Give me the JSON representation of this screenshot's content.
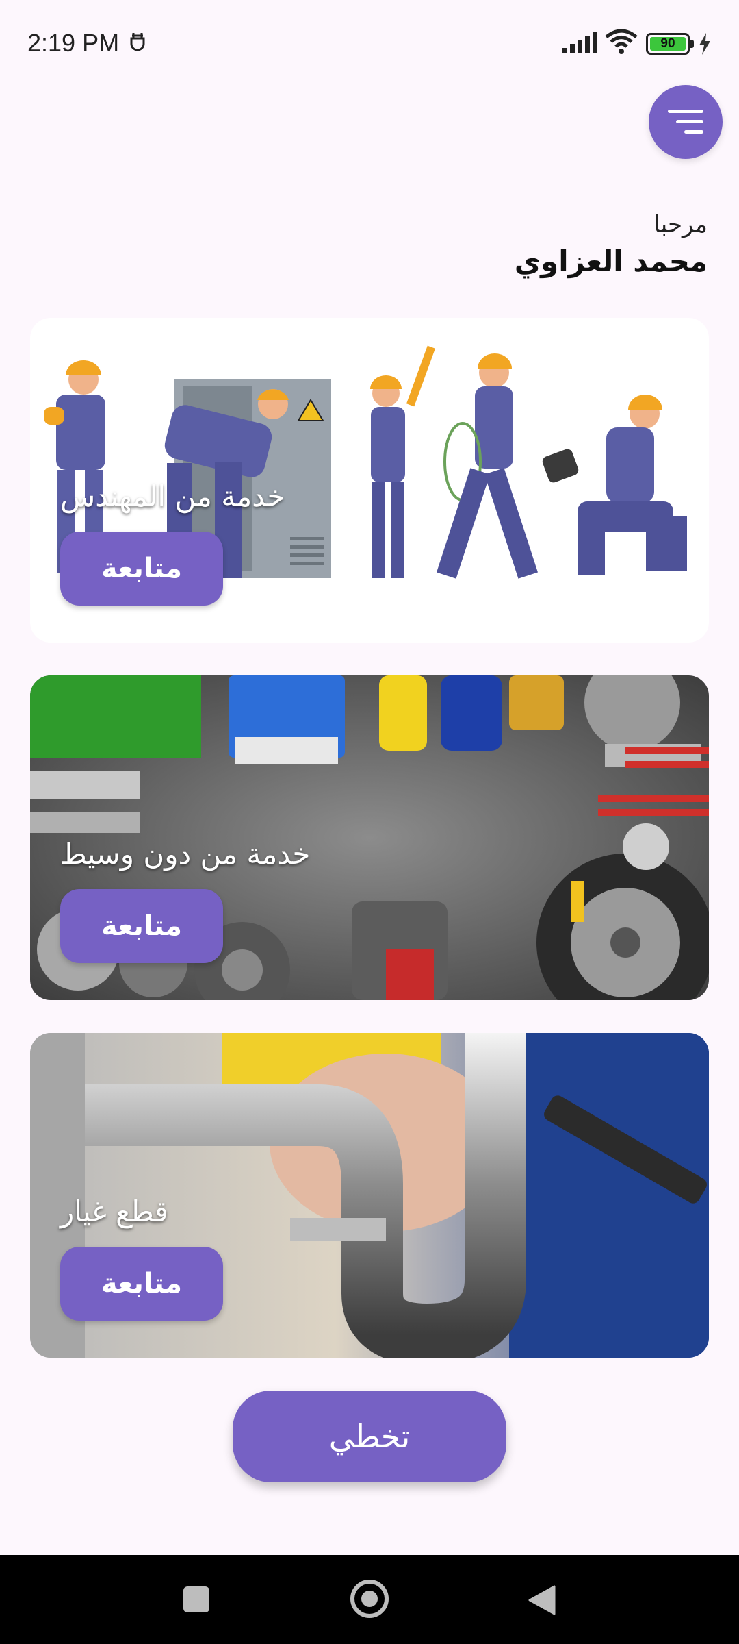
{
  "status_bar": {
    "time": "2:19 PM",
    "battery_level": "90",
    "icons": [
      "notification-icon",
      "signal-icon",
      "wifi-icon",
      "battery-icon",
      "charging-icon"
    ]
  },
  "menu": {
    "icon": "filter-menu-icon"
  },
  "greeting": {
    "label": "مرحبا",
    "name": "محمد العزاوي"
  },
  "cards": [
    {
      "title": "خدمة من المهندس",
      "button": "متابعة",
      "image": "workers-illustration"
    },
    {
      "title": "خدمة من دون وسيط",
      "button": "متابعة",
      "image": "car-parts-photo"
    },
    {
      "title": "قطع غيار",
      "button": "متابعة",
      "image": "plumber-pipe-photo"
    }
  ],
  "skip_button": "تخطي",
  "nav_bar": {
    "icons": [
      "recent-apps-icon",
      "home-icon",
      "back-icon"
    ]
  },
  "colors": {
    "accent": "#7661c4",
    "background": "#fdf7fd"
  }
}
